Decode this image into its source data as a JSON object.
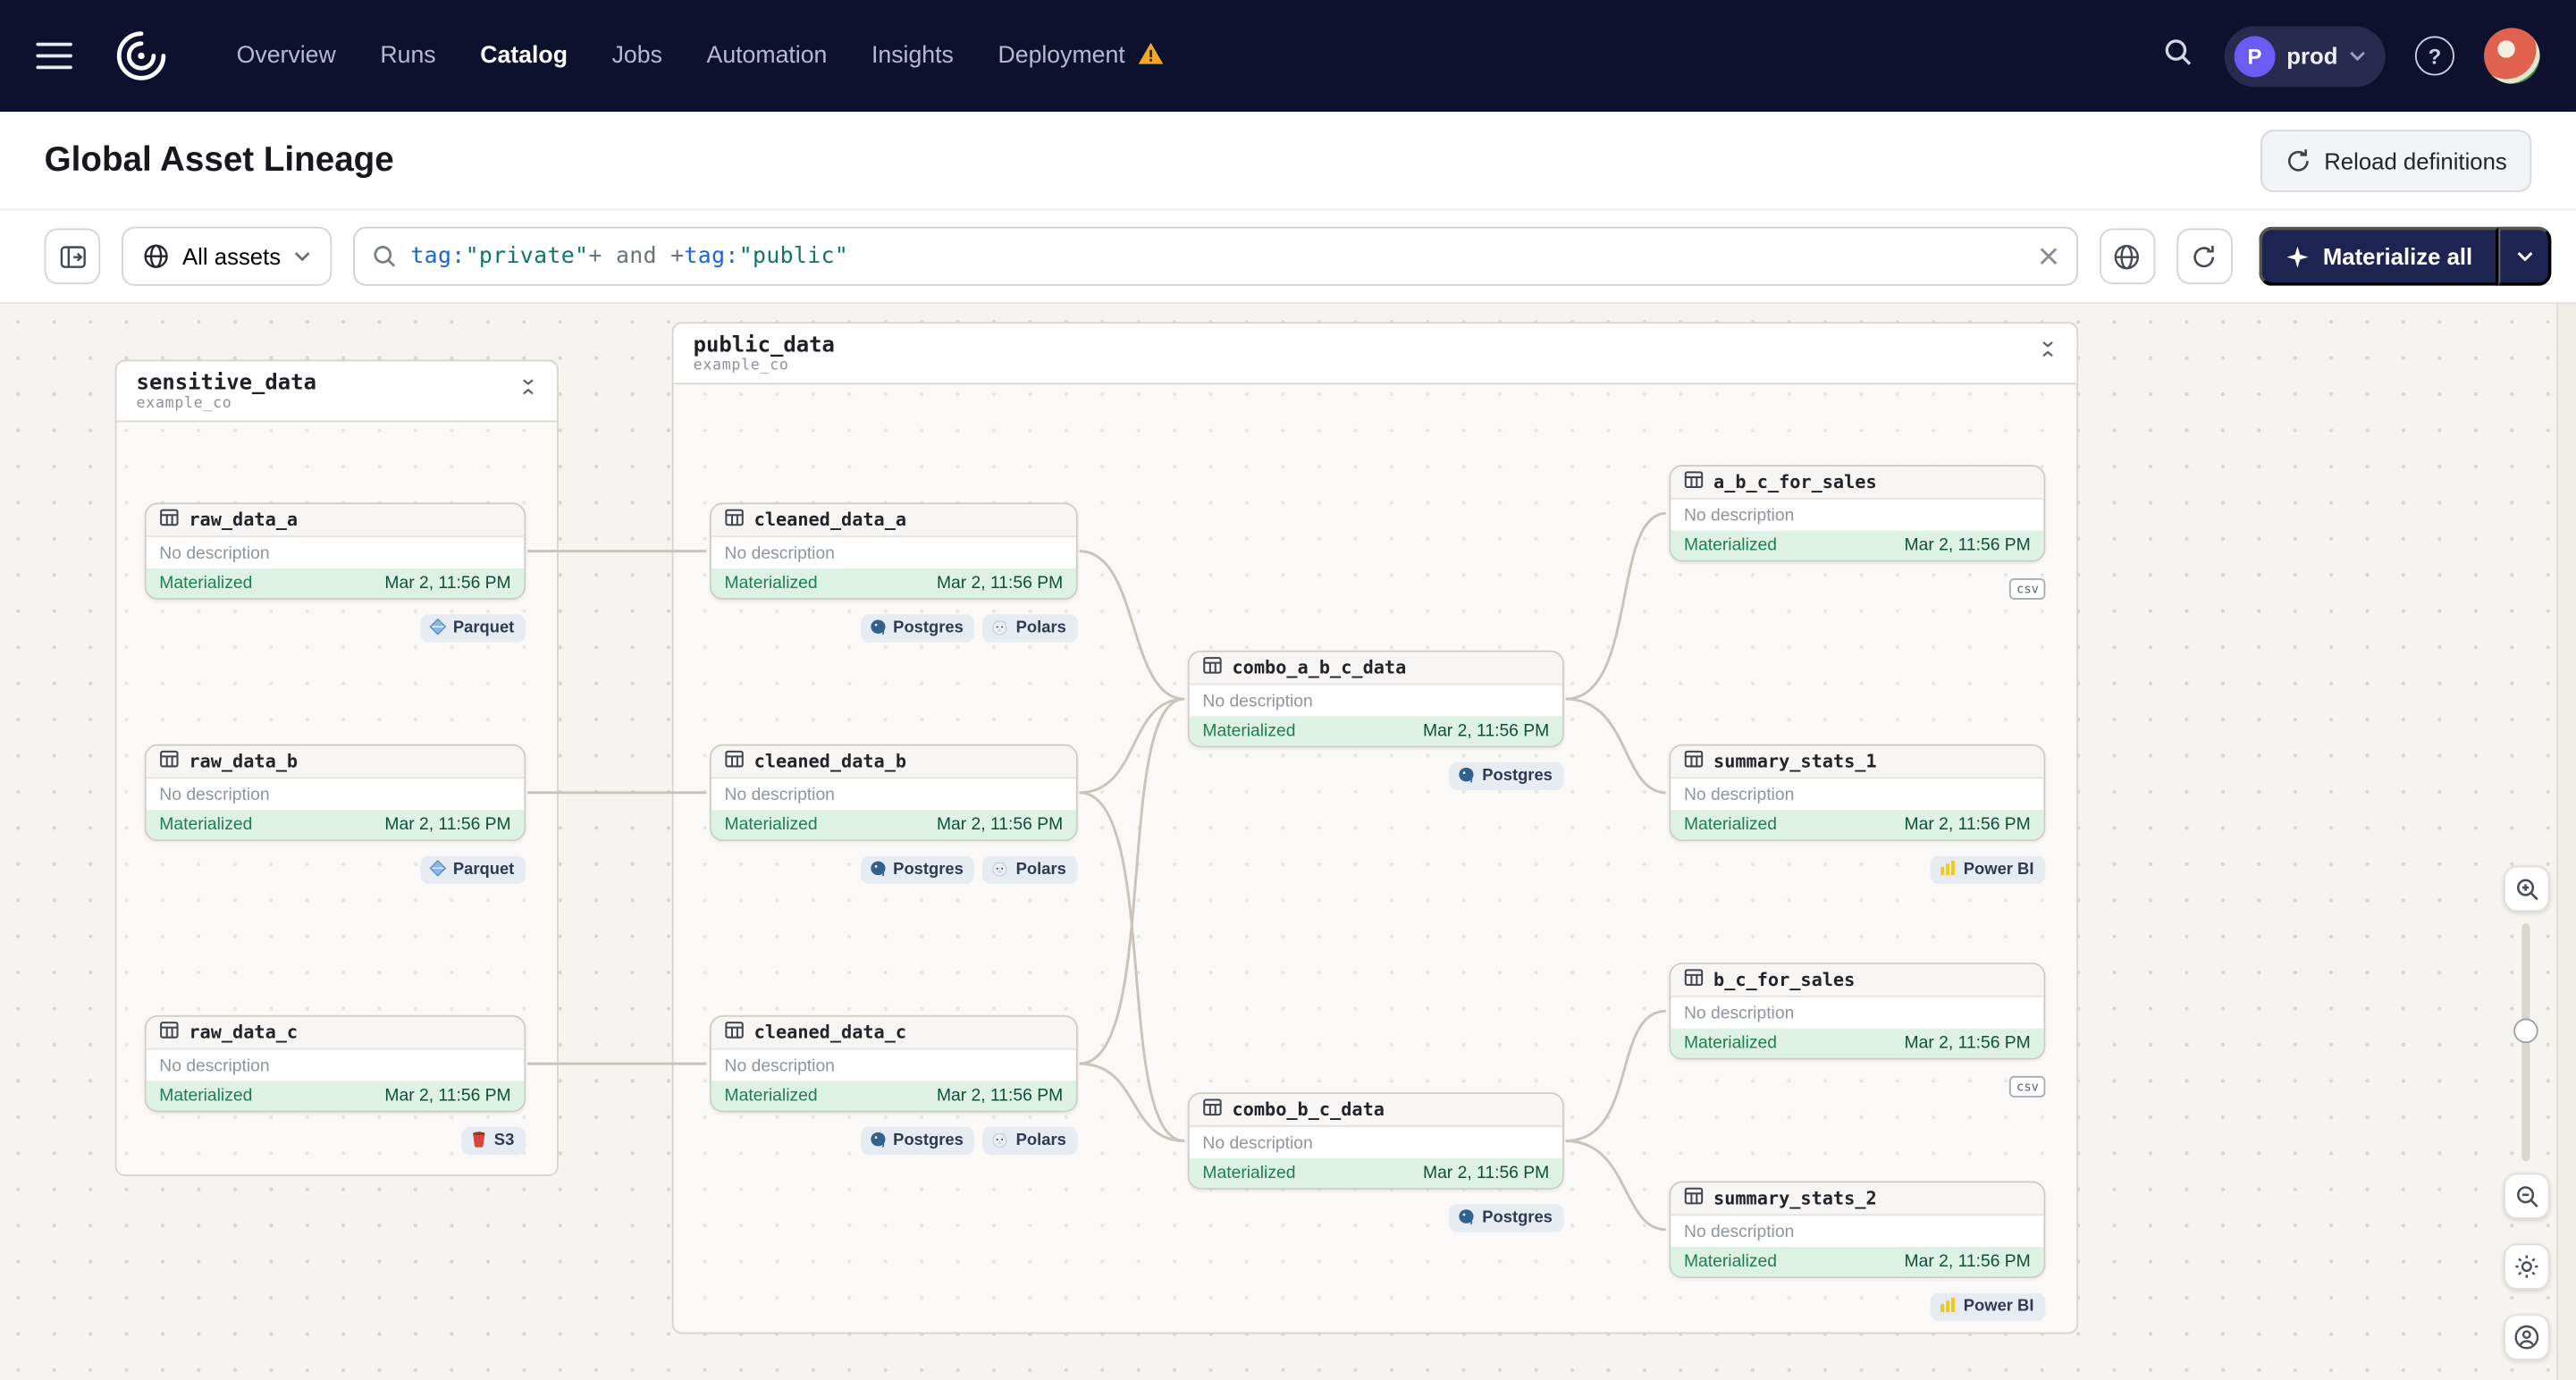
{
  "navbar": {
    "brand": "Dagster",
    "items": [
      {
        "label": "Overview"
      },
      {
        "label": "Runs"
      },
      {
        "label": "Catalog"
      },
      {
        "label": "Jobs"
      },
      {
        "label": "Automation"
      },
      {
        "label": "Insights"
      },
      {
        "label": "Deployment"
      }
    ],
    "active_item": "Catalog",
    "environment": {
      "badge": "P",
      "name": "prod"
    }
  },
  "header": {
    "title": "Global Asset Lineage",
    "reload_button_label": "Reload definitions"
  },
  "toolbar": {
    "scope_selector_label": "All assets",
    "search_query": "tag:\"private\"+ and +tag:\"public\"",
    "query_tokens": [
      {
        "text": "tag:",
        "type": "key"
      },
      {
        "text": "\"private\"",
        "type": "value"
      },
      {
        "text": "+",
        "type": "op"
      },
      {
        "text": " and ",
        "type": "op"
      },
      {
        "text": "+",
        "type": "op"
      },
      {
        "text": "tag:",
        "type": "key"
      },
      {
        "text": "\"public\"",
        "type": "value"
      }
    ],
    "materialize_button_label": "Materialize all"
  },
  "colors": {
    "navbar_bg": "#0e112e",
    "accent_dark_button": "#1e2452",
    "materialized_bg": "#ddf1e4",
    "materialized_text": "#1e7e4f",
    "warning_orange": "#f5a623"
  },
  "graph": {
    "groups": [
      {
        "name": "sensitive_data",
        "subtitle": "example_co",
        "nodes": [
          {
            "name": "raw_data_a",
            "description": "No description",
            "status": "Materialized",
            "timestamp": "Mar 2, 11:56 PM",
            "tags": [
              {
                "label": "Parquet",
                "icon": "parquet-icon"
              }
            ]
          },
          {
            "name": "raw_data_b",
            "description": "No description",
            "status": "Materialized",
            "timestamp": "Mar 2, 11:56 PM",
            "tags": [
              {
                "label": "Parquet",
                "icon": "parquet-icon"
              }
            ]
          },
          {
            "name": "raw_data_c",
            "description": "No description",
            "status": "Materialized",
            "timestamp": "Mar 2, 11:56 PM",
            "tags": [
              {
                "label": "S3",
                "icon": "s3-icon"
              }
            ]
          }
        ]
      },
      {
        "name": "public_data",
        "subtitle": "example_co",
        "nodes": [
          {
            "name": "cleaned_data_a",
            "description": "No description",
            "status": "Materialized",
            "timestamp": "Mar 2, 11:56 PM",
            "tags": [
              {
                "label": "Postgres",
                "icon": "postgres-icon"
              },
              {
                "label": "Polars",
                "icon": "polars-icon"
              }
            ]
          },
          {
            "name": "cleaned_data_b",
            "description": "No description",
            "status": "Materialized",
            "timestamp": "Mar 2, 11:56 PM",
            "tags": [
              {
                "label": "Postgres",
                "icon": "postgres-icon"
              },
              {
                "label": "Polars",
                "icon": "polars-icon"
              }
            ]
          },
          {
            "name": "cleaned_data_c",
            "description": "No description",
            "status": "Materialized",
            "timestamp": "Mar 2, 11:56 PM",
            "tags": [
              {
                "label": "Postgres",
                "icon": "postgres-icon"
              },
              {
                "label": "Polars",
                "icon": "polars-icon"
              }
            ]
          },
          {
            "name": "combo_a_b_c_data",
            "description": "No description",
            "status": "Materialized",
            "timestamp": "Mar 2, 11:56 PM",
            "tags": [
              {
                "label": "Postgres",
                "icon": "postgres-icon"
              }
            ]
          },
          {
            "name": "a_b_c_for_sales",
            "description": "No description",
            "status": "Materialized",
            "timestamp": "Mar 2, 11:56 PM",
            "badge": "csv",
            "tags": []
          },
          {
            "name": "summary_stats_1",
            "description": "No description",
            "status": "Materialized",
            "timestamp": "Mar 2, 11:56 PM",
            "tags": [
              {
                "label": "Power BI",
                "icon": "powerbi-icon"
              }
            ]
          },
          {
            "name": "b_c_for_sales",
            "description": "No description",
            "status": "Materialized",
            "timestamp": "Mar 2, 11:56 PM",
            "badge": "csv",
            "tags": []
          },
          {
            "name": "combo_b_c_data",
            "description": "No description",
            "status": "Materialized",
            "timestamp": "Mar 2, 11:56 PM",
            "tags": [
              {
                "label": "Postgres",
                "icon": "postgres-icon"
              }
            ]
          },
          {
            "name": "summary_stats_2",
            "description": "No description",
            "status": "Materialized",
            "timestamp": "Mar 2, 11:56 PM",
            "tags": [
              {
                "label": "Power BI",
                "icon": "powerbi-icon"
              }
            ]
          }
        ]
      }
    ]
  }
}
